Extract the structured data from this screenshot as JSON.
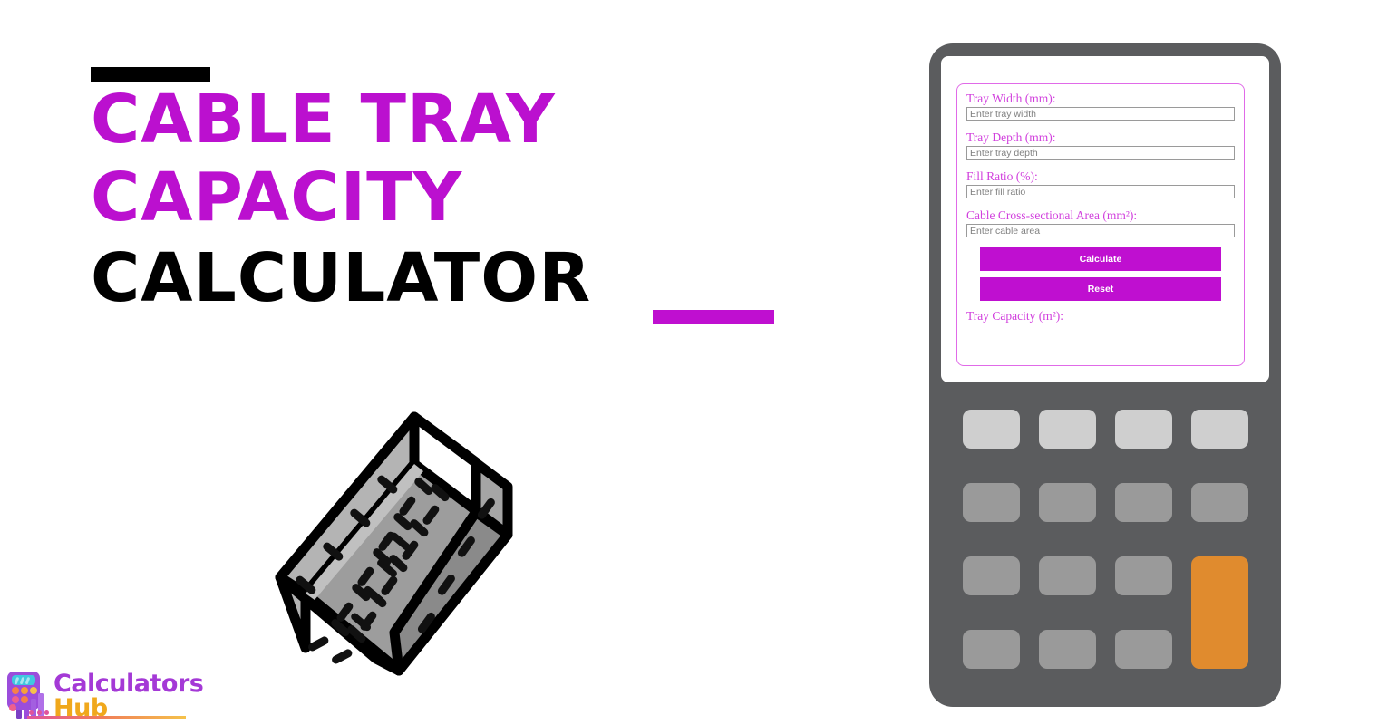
{
  "hero": {
    "title_line_1": "CABLE TRAY",
    "title_line_2": "CAPACITY",
    "title_line_3": "CALCULATOR",
    "accent_color": "#bb10cf",
    "rule_color_top": "#000000",
    "rule_color_bottom": "#bf0fd0",
    "illustration_name": "perforated-cable-tray",
    "illustration_colors": {
      "outline": "#000000",
      "face_light": "#b4b4b4",
      "face_mid": "#9d9d9d",
      "face_dark": "#8a8a8a"
    }
  },
  "logo": {
    "word_1": "Calculators",
    "word_2": "Hub",
    "word_1_color": "#a439d6",
    "word_2_color": "#f0a81c",
    "icon_name": "calculator-bars-icon"
  },
  "calculator": {
    "device_color": "#5b5c5e",
    "screen_color": "#ffffff",
    "form": {
      "border_color": "#e06ae8",
      "label_color": "#d13fdd",
      "fields": [
        {
          "label": "Tray Width (mm):",
          "placeholder": "Enter tray width",
          "value": "",
          "name": "tray-width"
        },
        {
          "label": "Tray Depth (mm):",
          "placeholder": "Enter tray depth",
          "value": "",
          "name": "tray-depth"
        },
        {
          "label": "Fill Ratio (%):",
          "placeholder": "Enter fill ratio",
          "value": "",
          "name": "fill-ratio"
        },
        {
          "label": "Cable Cross-sectional Area (mm²):",
          "placeholder": "Enter cable area",
          "value": "",
          "name": "cable-area"
        }
      ],
      "calculate_label": "Calculate",
      "reset_label": "Reset",
      "button_color": "#bf0fd0",
      "result_label": "Tray Capacity (m²):",
      "result_value": ""
    },
    "keypad": {
      "rows": 4,
      "columns": 4,
      "key_color_row1": "#cfcfcf",
      "key_color_default": "#9a9a9a",
      "accent_key_color": "#e08b2e"
    }
  }
}
